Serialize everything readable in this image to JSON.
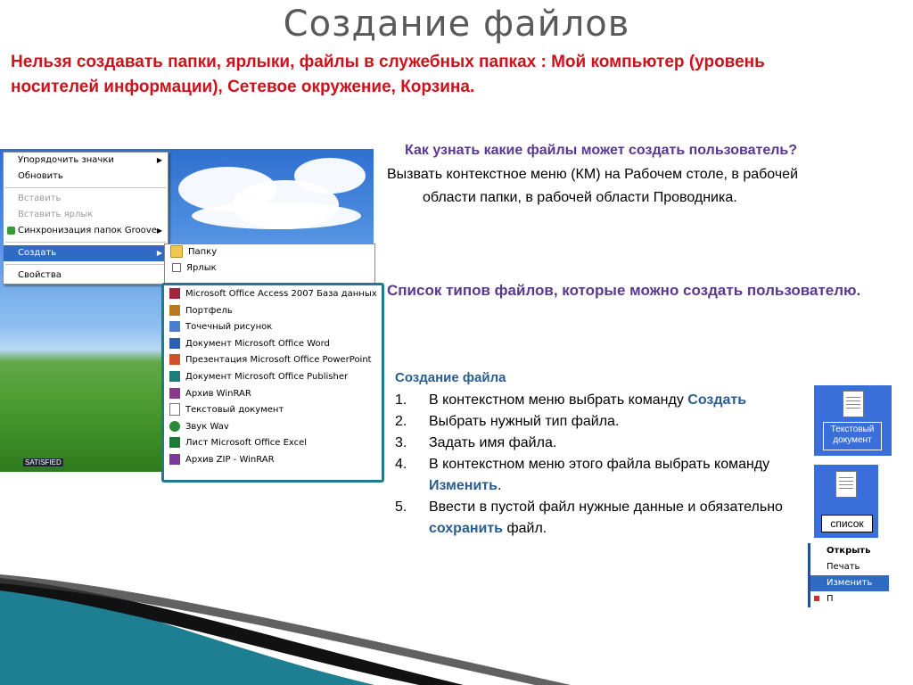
{
  "title": "Создание файлов",
  "warning": "Нельзя создавать папки, ярлыки, файлы в служебных папках : Мой компьютер (уровень носителей информации), Сетевое окружение, Корзина.",
  "desktop_menu": {
    "items": [
      {
        "label": "Упорядочить значки",
        "arrow": "▶",
        "disabled": false
      },
      {
        "label": "Обновить",
        "disabled": false
      },
      {
        "label": "Вставить",
        "disabled": true
      },
      {
        "label": "Вставить ярлык",
        "disabled": true
      },
      {
        "label": "Синхронизация папок Groove",
        "arrow": "▶",
        "disabled": false
      },
      {
        "label": "Создать",
        "arrow": "▶",
        "selected": true
      },
      {
        "label": "Свойства",
        "disabled": false
      }
    ],
    "logo_text": "SATISFIED"
  },
  "create_submenu": {
    "items": [
      {
        "label": "Папку",
        "icon": "folder-icon"
      },
      {
        "label": "Ярлык",
        "icon": "shortcut-icon"
      }
    ]
  },
  "file_types": [
    {
      "label": "Microsoft Office Access 2007 База данных",
      "icon": "access-icon",
      "color": "#a0253a"
    },
    {
      "label": "Портфель",
      "icon": "briefcase-icon",
      "color": "#b87a20"
    },
    {
      "label": "Точечный рисунок",
      "icon": "bitmap-icon",
      "color": "#4a7fd0"
    },
    {
      "label": "Документ Microsoft Office Word",
      "icon": "word-icon",
      "color": "#2b5fb4"
    },
    {
      "label": "Презентация Microsoft Office PowerPoint",
      "icon": "powerpoint-icon",
      "color": "#d0502a"
    },
    {
      "label": "Документ Microsoft Office Publisher",
      "icon": "publisher-icon",
      "color": "#1d7d7d"
    },
    {
      "label": "Архив WinRAR",
      "icon": "winrar-icon",
      "color": "#8a3a8a"
    },
    {
      "label": "Текстовый документ",
      "icon": "text-doc-icon",
      "color": "#6a6a6a"
    },
    {
      "label": "Звук Wav",
      "icon": "wav-icon",
      "color": "#2a8a3a"
    },
    {
      "label": "Лист Microsoft Office Excel",
      "icon": "excel-icon",
      "color": "#1e7a3a"
    },
    {
      "label": "Архив ZIP - WinRAR",
      "icon": "zip-icon",
      "color": "#7a3a9a"
    }
  ],
  "question": {
    "heading": "Как узнать какие файлы может создать пользователь?",
    "line1": "Вызвать контекстное меню (КМ) на Рабочем столе, в рабочей",
    "line2": "области папки, в рабочей области Проводника."
  },
  "list_heading": "Список  типов файлов, которые можно создать пользователю.",
  "steps": {
    "heading": "Создание файла",
    "items": [
      {
        "num": "1.",
        "text": "В контекстном меню выбрать команду ",
        "kw": "Создать",
        "after": ""
      },
      {
        "num": "2.",
        "text": "Выбрать нужный тип файла.",
        "kw": "",
        "after": ""
      },
      {
        "num": "3.",
        "text": "Задать имя файла.",
        "kw": "",
        "after": ""
      },
      {
        "num": "4.",
        "text": "В контекстном меню этого файла выбрать команду ",
        "kw": "Изменить",
        "after": "."
      },
      {
        "num": "5.",
        "text": "Ввести в пустой файл нужные данные и обязательно ",
        "kw": "сохранить",
        "after": " файл."
      }
    ]
  },
  "thumbs": {
    "new_file_name": "Текстовый документ",
    "renamed": "список",
    "ctx_items": [
      "Открыть",
      "Печать",
      "Изменить",
      "П"
    ]
  }
}
